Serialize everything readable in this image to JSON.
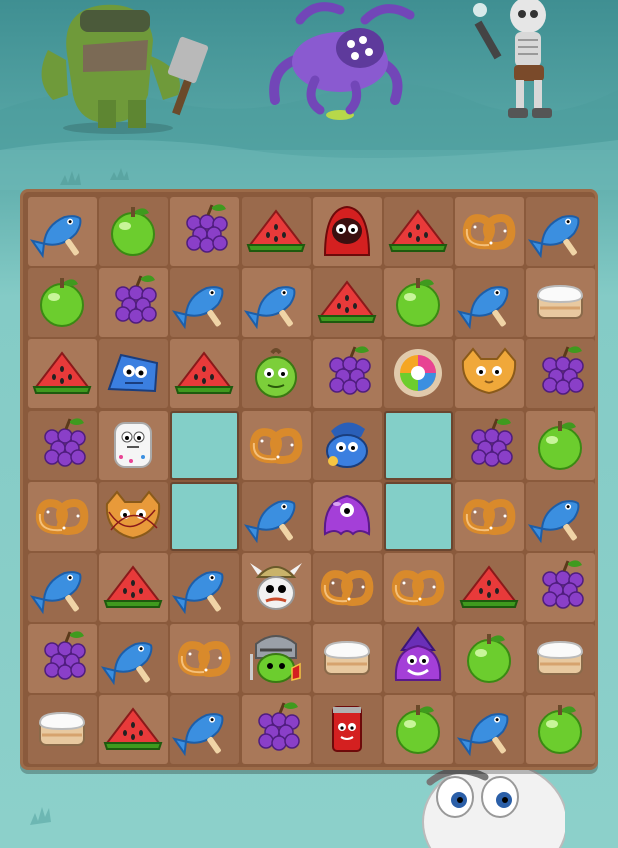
{
  "board": {
    "rows": 8,
    "cols": 8,
    "cells": [
      [
        "fish",
        "apple",
        "grapes",
        "watermelon",
        "red-hood-monster",
        "watermelon",
        "pretzel",
        "fish"
      ],
      [
        "apple",
        "grapes",
        "fish",
        "fish",
        "watermelon",
        "apple",
        "fish",
        "cake"
      ],
      [
        "watermelon",
        "blue-block-monster",
        "watermelon",
        "zombie-apple",
        "grapes",
        "rainbow-orb",
        "cat-pastry-monster",
        "grapes"
      ],
      [
        "grapes",
        "marshmallow-monster",
        "empty",
        "pretzel",
        "blue-wizard-monster",
        "empty",
        "grapes",
        "apple"
      ],
      [
        "pretzel",
        "tangled-pastry-monster",
        "empty",
        "fish",
        "purple-jelly-monster",
        "empty",
        "pretzel",
        "fish"
      ],
      [
        "fish",
        "watermelon",
        "fish",
        "viking-monster",
        "pretzel",
        "pretzel",
        "watermelon",
        "grapes"
      ],
      [
        "grapes",
        "fish",
        "pretzel",
        "knight-monster",
        "cake",
        "purple-wizard-monster",
        "apple",
        "cake"
      ],
      [
        "cake",
        "watermelon",
        "fish",
        "grapes",
        "soda-can-monster",
        "apple",
        "fish",
        "apple"
      ]
    ]
  },
  "enemies": [
    "orc-warrior",
    "purple-spider",
    "skeleton",
    "king-hero"
  ],
  "colors": {
    "background": "#7fc7c4",
    "board": "#8a5a3c",
    "tile_light": "#a97859",
    "tile_dark": "#9a6a4c",
    "hole": "#83cfc8"
  }
}
